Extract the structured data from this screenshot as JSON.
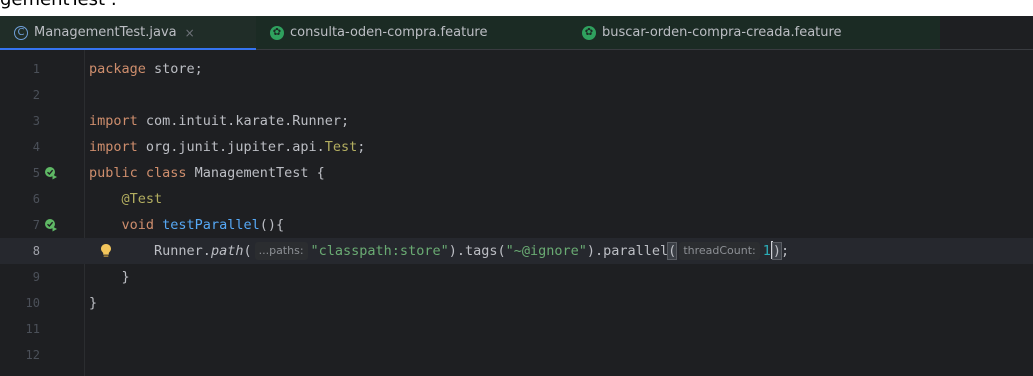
{
  "top_caption": "gementTest :",
  "tabs": [
    {
      "label": "ManagementTest.java",
      "icon": "java-class-icon",
      "close": "×",
      "active": true
    },
    {
      "label": "consulta-oden-compra.feature",
      "icon": "cucumber-icon",
      "active": false
    },
    {
      "label": "buscar-orden-compra-creada.feature",
      "icon": "cucumber-icon",
      "active": false
    }
  ],
  "editor": {
    "current_line": 8,
    "line_numbers": [
      "1",
      "2",
      "3",
      "4",
      "5",
      "6",
      "7",
      "8",
      "9",
      "10",
      "11",
      "12"
    ],
    "code": {
      "l1_kw": "package",
      "l1_rest": " store;",
      "l3_kw": "import",
      "l3_rest": " com.intuit.karate.Runner;",
      "l4_kw": "import",
      "l4_rest": " org.junit.jupiter.api.",
      "l4_cls": "Test",
      "l4_end": ";",
      "l5_kw": "public class",
      "l5_rest": " ManagementTest {",
      "l6_indent": "    ",
      "l6_ann": "@Test",
      "l7_indent": "    ",
      "l7_kw": "void",
      "l7_sp": " ",
      "l7_fn": "testParallel",
      "l7_rest": "(){",
      "l8_indent": "        ",
      "l8_a": "Runner.",
      "l8_b": "path",
      "l8_c": "(",
      "l8_hint1": "...paths:",
      "l8_str1": "\"classpath:store\"",
      "l8_d": ").tags(",
      "l8_str2": "\"~@ignore\"",
      "l8_e": ").parallel",
      "l8_f": "(",
      "l8_hint2": "threadCount:",
      "l8_num": "1",
      "l8_g": ")",
      "l8_h": ";",
      "l9_text": "    }",
      "l10_text": "}"
    }
  },
  "colors": {
    "background": "#1e1f22",
    "keyword": "#cf8e6d",
    "string": "#6aab73",
    "number": "#2aacb8",
    "annotation": "#b3ae60",
    "method": "#56a8f5"
  }
}
